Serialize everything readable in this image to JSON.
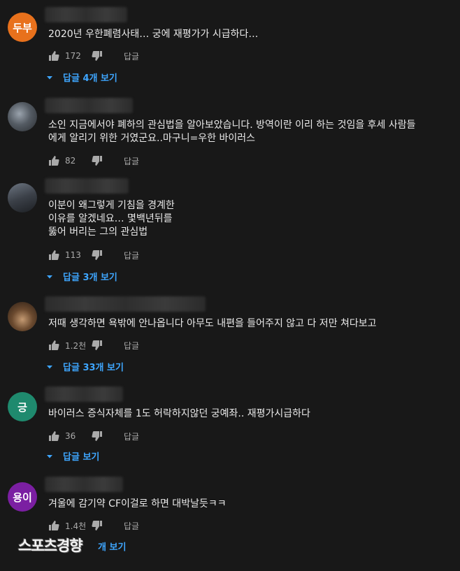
{
  "comments": [
    {
      "avatar": {
        "label": "두부",
        "color": "#e8711c"
      },
      "text": "2020년 우한폐렴사태… 궁에 재평가가 시급하다…",
      "likes": "172",
      "reply_label": "답글",
      "replies_label": "답글 4개 보기"
    },
    {
      "avatar": {
        "label": "",
        "color": ""
      },
      "text": "소인 지금에서야 폐하의 관심법을 알아보았습니다. 방역이란 이리 하는 것임을 후세 사람들\n에게 알리기 위한 거였군요..마구니=우한 바이러스",
      "likes": "82",
      "reply_label": "답글",
      "replies_label": ""
    },
    {
      "avatar": {
        "label": "",
        "color": ""
      },
      "text": "이분이 왜그렇게 기침을 경계한\n이유를 알겠네요… 몇백년뒤를\n뚫어 버리는 그의 관심법",
      "likes": "113",
      "reply_label": "답글",
      "replies_label": "답글 3개 보기"
    },
    {
      "avatar": {
        "label": "",
        "color": ""
      },
      "text": "저때 생각하면 욕밖에 안나옵니다 아무도 내편을 들어주지 않고 다 저만 쳐다보고",
      "likes": "1.2천",
      "reply_label": "답글",
      "replies_label": "답글 33개 보기"
    },
    {
      "avatar": {
        "label": "긍",
        "color": "#1f8a6e"
      },
      "text": "바이러스  증식자체를 1도 허락하지않던 궁예좌.. 재평가시급하다",
      "likes": "36",
      "reply_label": "답글",
      "replies_label": "답글 보기"
    },
    {
      "avatar": {
        "label": "용이",
        "color": "#7b1fa2"
      },
      "text": "겨울에 감기약 CF이걸로 하면 대박날듯ㅋㅋ",
      "likes": "1.4천",
      "reply_label": "답글",
      "replies_label": "개 보기"
    }
  ],
  "icons": {
    "like": "thumbs-up-icon",
    "dislike": "thumbs-down-icon",
    "expand": "caret-down-icon"
  },
  "colors": {
    "link": "#3ea6ff",
    "background": "#181818"
  },
  "watermark": "스포츠경향"
}
